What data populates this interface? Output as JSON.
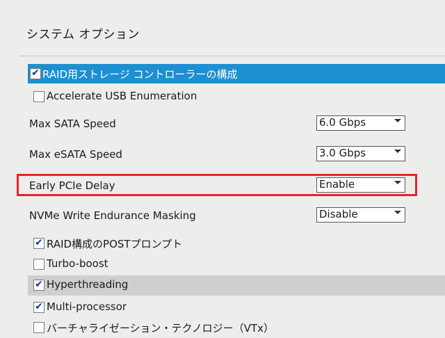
{
  "page": {
    "title": "システム オプション"
  },
  "options": {
    "raid_storage": {
      "label": "RAID用ストレージ コントローラーの構成",
      "checked": true
    },
    "accel_usb": {
      "label": "Accelerate USB Enumeration",
      "checked": false
    },
    "max_sata": {
      "label": "Max SATA Speed",
      "value": "6.0 Gbps"
    },
    "max_esata": {
      "label": "Max eSATA Speed",
      "value": "3.0 Gbps"
    },
    "early_pcie": {
      "label": "Early PCIe Delay",
      "value": "Enable"
    },
    "nvme": {
      "label": "NVMe Write Endurance Masking",
      "value": "Disable"
    },
    "raid_post": {
      "label": "RAID構成のPOSTプロンプト",
      "checked": true
    },
    "turbo": {
      "label": "Turbo-boost",
      "checked": false
    },
    "hyperthreading": {
      "label": "Hyperthreading",
      "checked": true
    },
    "multiproc": {
      "label": "Multi-processor",
      "checked": true
    },
    "vtx": {
      "label": "バーチャライゼーション・テクノロジー（VTx）",
      "checked": false
    }
  },
  "colors": {
    "selection": "#1e8fd0",
    "highlight_box": "#e8232a",
    "hover_row": "#cfcfcd"
  }
}
